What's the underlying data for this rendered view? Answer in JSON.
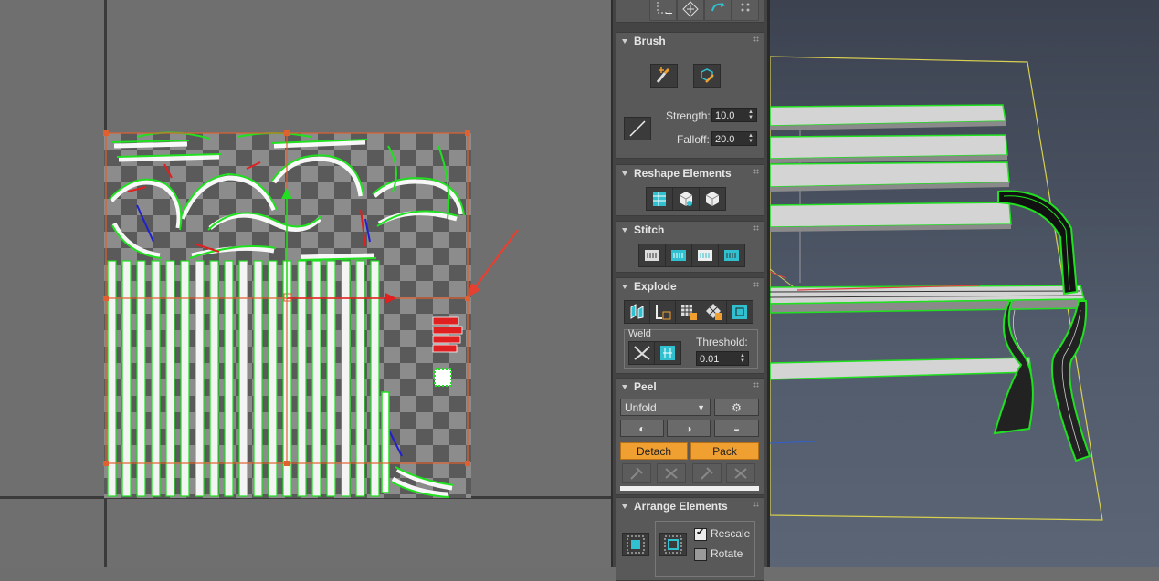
{
  "uv_editor": {
    "name": "uv-editor"
  },
  "modifier_panel": {
    "brush": {
      "title": "Brush",
      "strength_label": "Strength:",
      "strength_value": "10.0",
      "falloff_label": "Falloff:",
      "falloff_value": "20.0"
    },
    "reshape": {
      "title": "Reshape Elements"
    },
    "stitch": {
      "title": "Stitch"
    },
    "explode": {
      "title": "Explode",
      "weld_label": "Weld",
      "threshold_label": "Threshold:",
      "threshold_value": "0.01"
    },
    "peel": {
      "title": "Peel",
      "mode_value": "Unfold",
      "detach_label": "Detach",
      "pack_label": "Pack"
    },
    "arrange": {
      "title": "Arrange Elements",
      "rescale_label": "Rescale",
      "rescale_checked": true,
      "rotate_label": "Rotate",
      "rotate_checked": false
    }
  },
  "colors": {
    "accent_orange": "#f0a030",
    "uv_wire_green": "#20e020",
    "uv_selection_red": "#e03020",
    "bounding_box_yellow": "#d8d050"
  }
}
